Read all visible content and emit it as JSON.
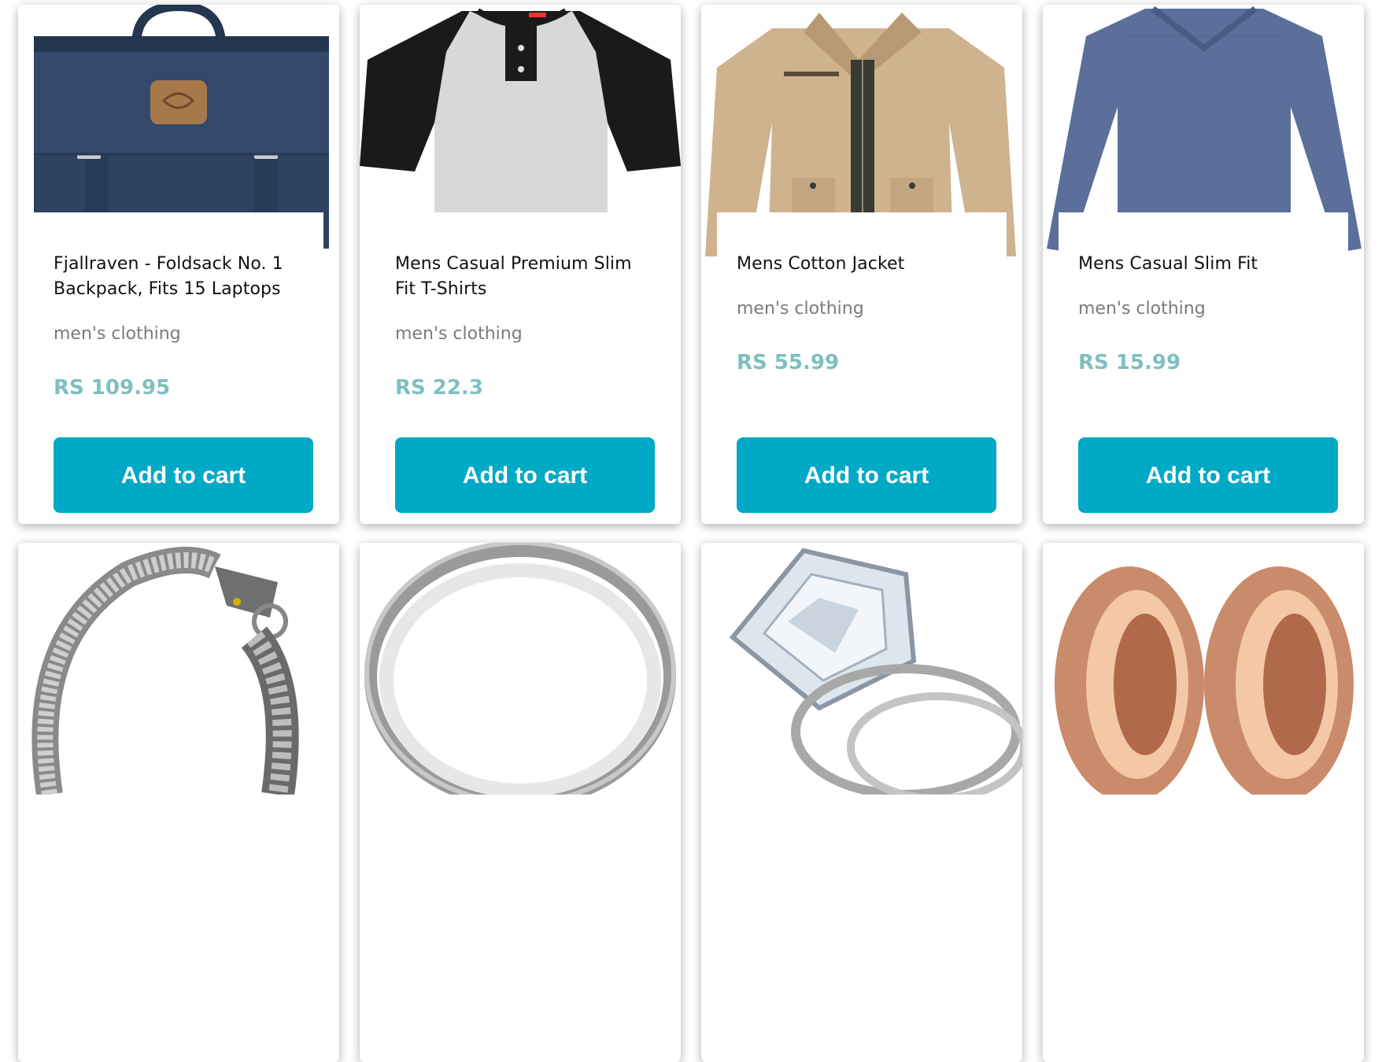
{
  "products": [
    {
      "title": "Fjallraven - Foldsack No. 1 Backpack, Fits 15 Laptops",
      "category": "men's clothing",
      "price": "RS 109.95",
      "button": "Add to cart",
      "image_icon": "backpack-image"
    },
    {
      "title": "Mens Casual Premium Slim Fit T-Shirts",
      "category": "men's clothing",
      "price": "RS 22.3",
      "button": "Add to cart",
      "image_icon": "tshirt-image"
    },
    {
      "title": "Mens Cotton Jacket",
      "category": "men's clothing",
      "price": "RS 55.99",
      "button": "Add to cart",
      "image_icon": "jacket-image"
    },
    {
      "title": "Mens Casual Slim Fit",
      "category": "men's clothing",
      "price": "RS 15.99",
      "button": "Add to cart",
      "image_icon": "longsleeve-shirt-image"
    }
  ],
  "second_row_images": [
    "bracelet-image",
    "silver-ring-image",
    "diamond-ring-image",
    "rose-gold-plugs-image"
  ],
  "colors": {
    "button": "#00a9c6",
    "price": "#7fbfc0",
    "category": "#7a7a7a"
  }
}
